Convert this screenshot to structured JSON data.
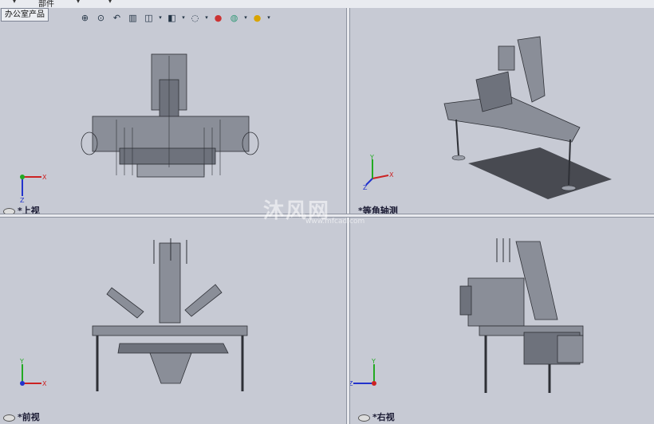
{
  "top": {
    "title": "部件"
  },
  "tab": {
    "label": "办公室产品"
  },
  "toolbar": {
    "icons": [
      "zoom-to-fit-icon",
      "zoom-area-icon",
      "previous-view-icon",
      "section-view-icon",
      "view-orientation-icon",
      "display-style-icon",
      "hide-show-icon",
      "edit-appearance-icon",
      "apply-scene-icon",
      "render-icon"
    ]
  },
  "views": {
    "top": {
      "label": "*上视"
    },
    "iso": {
      "label": "*等角轴测"
    },
    "front": {
      "label": "*前视"
    },
    "right": {
      "label": "*右视"
    }
  },
  "triad": {
    "x": "X",
    "y": "Y",
    "z": "Z"
  },
  "watermark": {
    "text": "沐风网",
    "url": "www.mfcad.com"
  },
  "colors": {
    "viewport_bg": "#c7cad4",
    "model": "#5d616b",
    "x_axis": "#cc2222",
    "y_axis": "#22aa22",
    "z_axis": "#2233cc"
  }
}
